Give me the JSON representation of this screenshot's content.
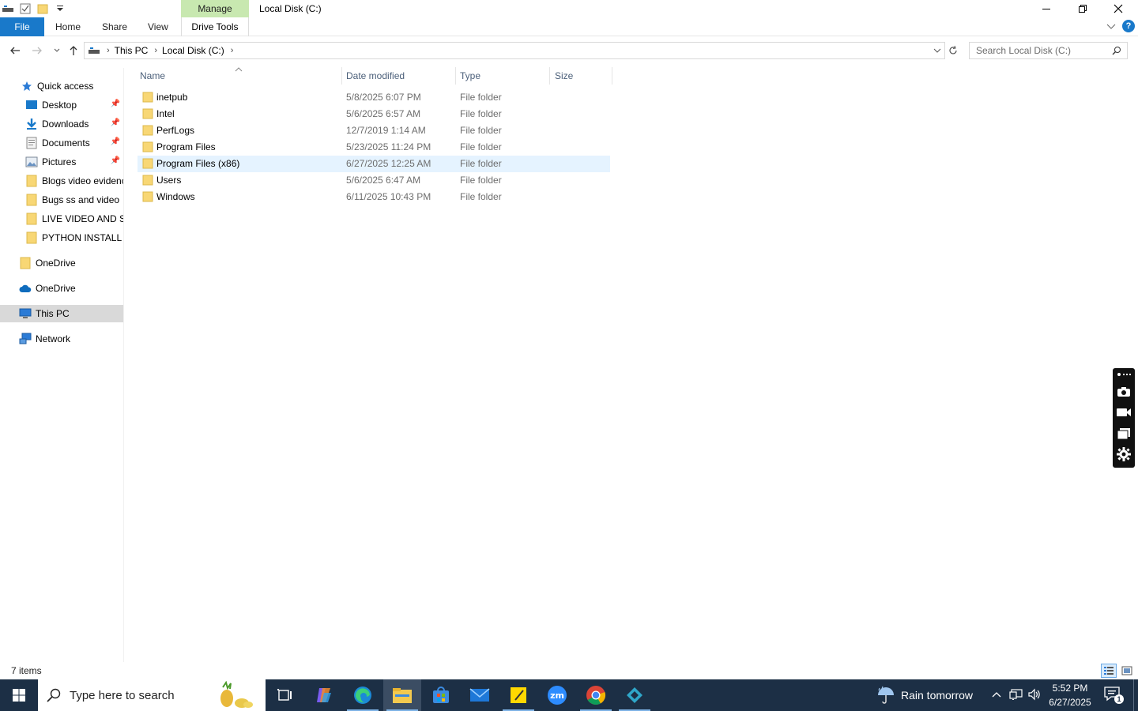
{
  "window": {
    "title": "Local Disk (C:)",
    "contextual_group": "Manage",
    "controls": [
      "minimize",
      "restore",
      "close"
    ]
  },
  "ribbon": {
    "tabs": [
      "File",
      "Home",
      "Share",
      "View"
    ],
    "contextual_tab": "Drive Tools",
    "help": "?"
  },
  "address": {
    "crumbs": [
      "This PC",
      "Local Disk (C:)"
    ],
    "search_placeholder": "Search Local Disk (C:)"
  },
  "nav": {
    "quick_access": "Quick access",
    "pinned": [
      {
        "label": "Desktop",
        "icon": "desktop-icon"
      },
      {
        "label": "Downloads",
        "icon": "download-icon"
      },
      {
        "label": "Documents",
        "icon": "documents-icon"
      },
      {
        "label": "Pictures",
        "icon": "pictures-icon"
      }
    ],
    "recent": [
      "Blogs video evidenc",
      "Bugs ss and  video",
      "LIVE VIDEO AND SS",
      "PYTHON INSTALL A"
    ],
    "onedrive_folder": "OneDrive",
    "onedrive_cloud": "OneDrive",
    "this_pc": "This PC",
    "network": "Network"
  },
  "columns": {
    "name": "Name",
    "date": "Date modified",
    "type": "Type",
    "size": "Size"
  },
  "files": [
    {
      "name": "inetpub",
      "date": "5/8/2025 6:07 PM",
      "type": "File folder"
    },
    {
      "name": "Intel",
      "date": "5/6/2025 6:57 AM",
      "type": "File folder"
    },
    {
      "name": "PerfLogs",
      "date": "12/7/2019 1:14 AM",
      "type": "File folder"
    },
    {
      "name": "Program Files",
      "date": "5/23/2025 11:24 PM",
      "type": "File folder"
    },
    {
      "name": "Program Files (x86)",
      "date": "6/27/2025 12:25 AM",
      "type": "File folder"
    },
    {
      "name": "Users",
      "date": "5/6/2025 6:47 AM",
      "type": "File folder"
    },
    {
      "name": "Windows",
      "date": "6/11/2025 10:43 PM",
      "type": "File folder"
    }
  ],
  "status": {
    "item_count": "7 items"
  },
  "taskbar": {
    "search_placeholder": "Type here to search",
    "weather": "Rain tomorrow",
    "time": "5:52 PM",
    "date": "6/27/2025",
    "notification_count": "1"
  },
  "colors": {
    "file_tab": "#1979ca",
    "manage_tab": "#c8e8b0",
    "selection": "#e5f3ff",
    "taskbar": "#1c2f45",
    "folder": "#f8d775"
  }
}
